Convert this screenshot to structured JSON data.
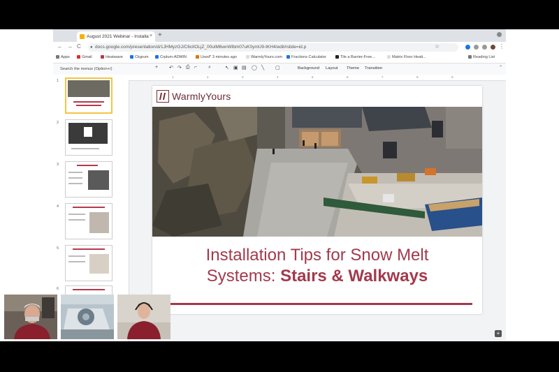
{
  "browser": {
    "tab_title": "August 2021 Webinar - Installa",
    "tab_close": "×",
    "new_tab": "+",
    "url": "docs.google.com/presentation/d/1JHMyzGJ/C6clIOLjZ_00ulM6wnWlbm07uK0ymU9-tKH4/edit#slide=id.p",
    "nav_back": "←",
    "nav_forward": "→",
    "nav_reload": "C",
    "star": "☆"
  },
  "bookmarks": {
    "apps": "Apps",
    "items": [
      "Gmail",
      "Heatwave",
      "Ckgrum",
      "Crplum-ADMIN",
      "Used* 3 minutes ago",
      "WarmlyYours.com",
      "Fractions Calculator",
      "Tile a Barrier-Free...",
      "Matrix Floor Heati..."
    ],
    "reading_list": "Reading List"
  },
  "toolbar": {
    "search_menus": "Search the menus (Option+/)",
    "background": "Background",
    "layout": "Layout",
    "theme": "Theme",
    "transition": "Transition"
  },
  "ruler": [
    "1",
    "2",
    "3",
    "4",
    "5",
    "6",
    "7",
    "8",
    "9"
  ],
  "filmstrip": {
    "numbers": [
      "1",
      "2",
      "3",
      "4",
      "5",
      "6"
    ]
  },
  "slide": {
    "logo_text": "WarmlyYours",
    "title_line1": "Installation Tips for Snow Melt",
    "title_line2_plain": "Systems: ",
    "title_line2_bold": "Stairs & Walkways",
    "accent_color": "#a23a4c"
  },
  "colors": {
    "brand": "#6b2a35",
    "selected_thumb": "#f6c343"
  }
}
